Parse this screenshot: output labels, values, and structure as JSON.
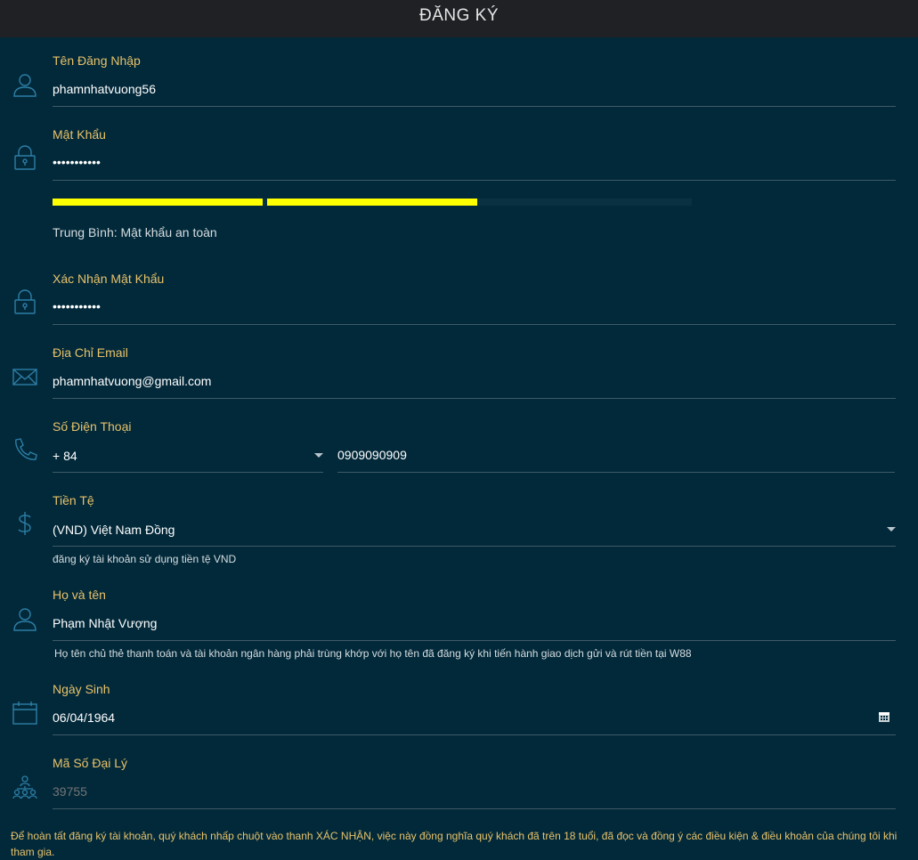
{
  "header": {
    "title": "ĐĂNG KÝ"
  },
  "username": {
    "label": "Tên Đăng Nhập",
    "value": "phamnhatvuong56"
  },
  "password": {
    "label": "Mật Khẩu",
    "value": "•••••••••••",
    "strength_text": "Trung Bình: Mật khẩu an toàn",
    "strength_fraction": 0.66,
    "strength_color": "#ffff00"
  },
  "confirm_password": {
    "label": "Xác Nhận Mật Khẩu",
    "value": "•••••••••••"
  },
  "email": {
    "label": "Địa Chỉ Email",
    "value": "phamnhatvuong@gmail.com"
  },
  "phone": {
    "label": "Số Điện Thoại",
    "country_code": "+ 84",
    "number": "0909090909"
  },
  "currency": {
    "label": "Tiền Tệ",
    "selected": "(VND) Việt Nam Đồng",
    "hint": "đăng ký tài khoản sử dụng tiền tệ VND"
  },
  "fullname": {
    "label": "Họ và tên",
    "value": "Phạm Nhật Vượng",
    "hint": "Họ tên chủ thẻ thanh toán và tài khoản ngân hàng phải trùng khớp với họ tên đã đăng ký khi tiến hành giao dịch gửi và rút tiền tại W88"
  },
  "birthday": {
    "label": "Ngày Sinh",
    "value": "06/04/1964"
  },
  "agent_code": {
    "label": "Mã Số Đại Lý",
    "placeholder": "39755"
  },
  "footer": {
    "terms": "Để hoàn tất đăng ký tài khoản, quý khách nhấp chuột vào thanh XÁC NHẬN, việc này đồng nghĩa quý khách đã trên 18 tuổi, đã đọc và đồng ý các điều kiện & điều khoản của chúng tôi khi tham gia."
  },
  "colors": {
    "background": "#02293a",
    "header": "#1f2124",
    "label": "#e8c26a",
    "icon": "#2d7ea6",
    "underline": "#3e5a66"
  },
  "icons": [
    "user-icon",
    "lock-icon",
    "envelope-icon",
    "phone-icon",
    "dollar-icon",
    "calendar-icon",
    "agent-network-icon",
    "calendar-picker-icon",
    "chevron-down-icon"
  ]
}
